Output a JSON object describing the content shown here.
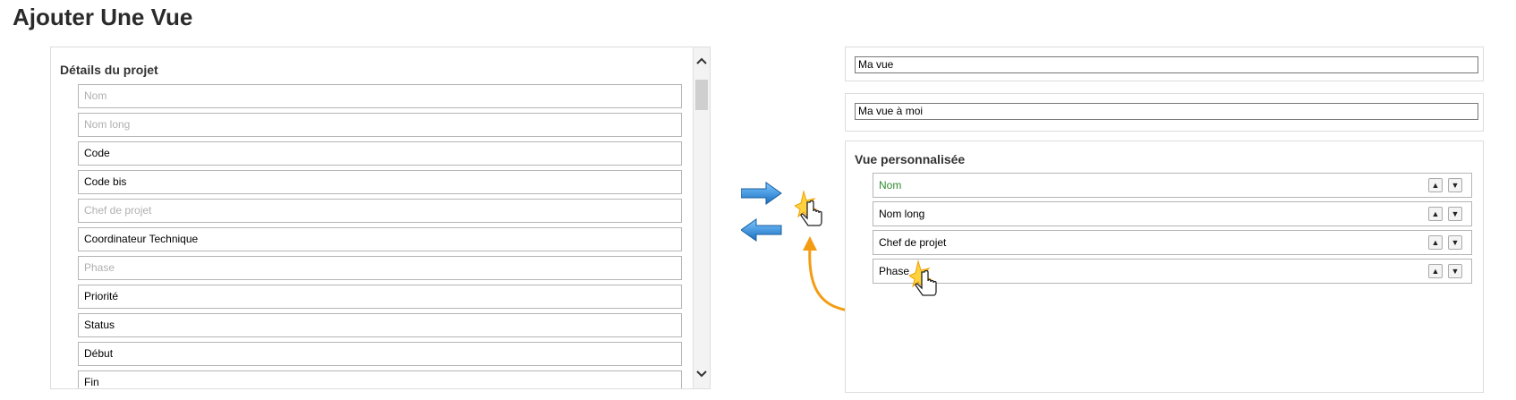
{
  "page_title": "Ajouter Une Vue",
  "left_panel": {
    "title": "Détails du projet",
    "fields": [
      {
        "label": "Nom",
        "disabled": true
      },
      {
        "label": "Nom long",
        "disabled": true
      },
      {
        "label": "Code",
        "disabled": false
      },
      {
        "label": "Code bis",
        "disabled": false
      },
      {
        "label": "Chef de projet",
        "disabled": true
      },
      {
        "label": "Coordinateur Technique",
        "disabled": false
      },
      {
        "label": "Phase",
        "disabled": true
      },
      {
        "label": "Priorité",
        "disabled": false
      },
      {
        "label": "Status",
        "disabled": false
      },
      {
        "label": "Début",
        "disabled": false
      },
      {
        "label": "Fin",
        "disabled": false
      }
    ],
    "scroll_up_icon": "chevron-up-icon",
    "scroll_down_icon": "chevron-down-icon"
  },
  "actions": {
    "move_right_icon": "arrow-right-icon",
    "move_left_icon": "arrow-left-icon"
  },
  "view_name_input": {
    "value": "Ma vue"
  },
  "view_description_input": {
    "value": "Ma vue à moi"
  },
  "custom_view": {
    "title": "Vue personnalisée",
    "items": [
      {
        "label": "Nom"
      },
      {
        "label": "Nom long"
      },
      {
        "label": "Chef de projet"
      },
      {
        "label": "Phase"
      }
    ],
    "up_icon": "arrow-up-icon",
    "down_icon": "arrow-down-icon"
  },
  "colors": {
    "arrow_blue": "#2f8fd8",
    "curve_orange": "#f39c12",
    "first_item_green": "#2e8b2e"
  }
}
